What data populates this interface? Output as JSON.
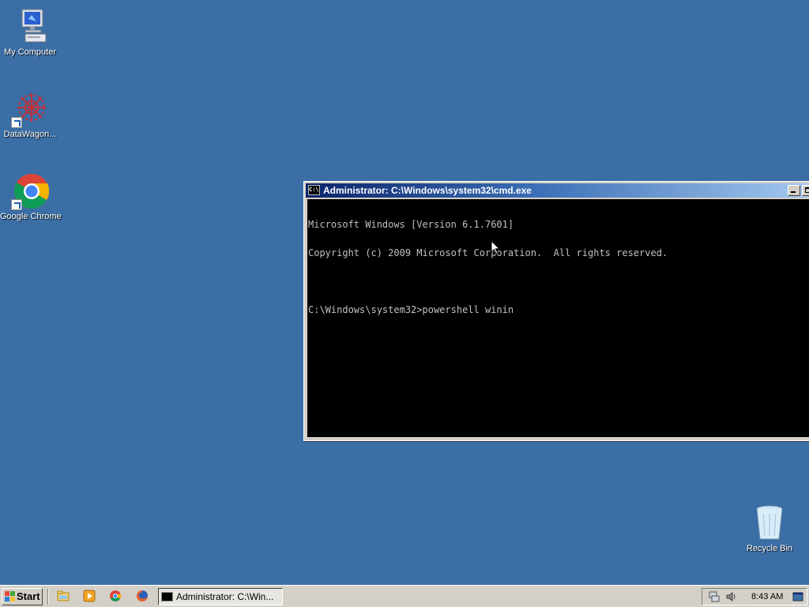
{
  "desktop": {
    "background_color": "#3a6ea5",
    "icons": [
      {
        "label": "My Computer",
        "icon": "computer-icon"
      },
      {
        "label": "DataWagon...",
        "icon": "datawagon-icon"
      },
      {
        "label": "Google Chrome",
        "icon": "chrome-icon"
      },
      {
        "label": "Recycle Bin",
        "icon": "recycle-bin-icon"
      }
    ]
  },
  "cmd_window": {
    "title": "Administrator: C:\\Windows\\system32\\cmd.exe",
    "icon_text": "C:\\",
    "lines": [
      "Microsoft Windows [Version 6.1.7601]",
      "Copyright (c) 2009 Microsoft Corporation.  All rights reserved.",
      "",
      "C:\\Windows\\system32>powershell winin"
    ]
  },
  "taskbar": {
    "start_label": "Start",
    "quick_launch": [
      "file-explorer-icon",
      "media-player-icon",
      "chrome-icon",
      "firefox-icon"
    ],
    "tasks": [
      {
        "label": "Administrator: C:\\Win..."
      }
    ],
    "tray_icons": [
      "network-icon",
      "volume-icon",
      "show-desktop-icon"
    ],
    "clock": "8:43 AM"
  }
}
